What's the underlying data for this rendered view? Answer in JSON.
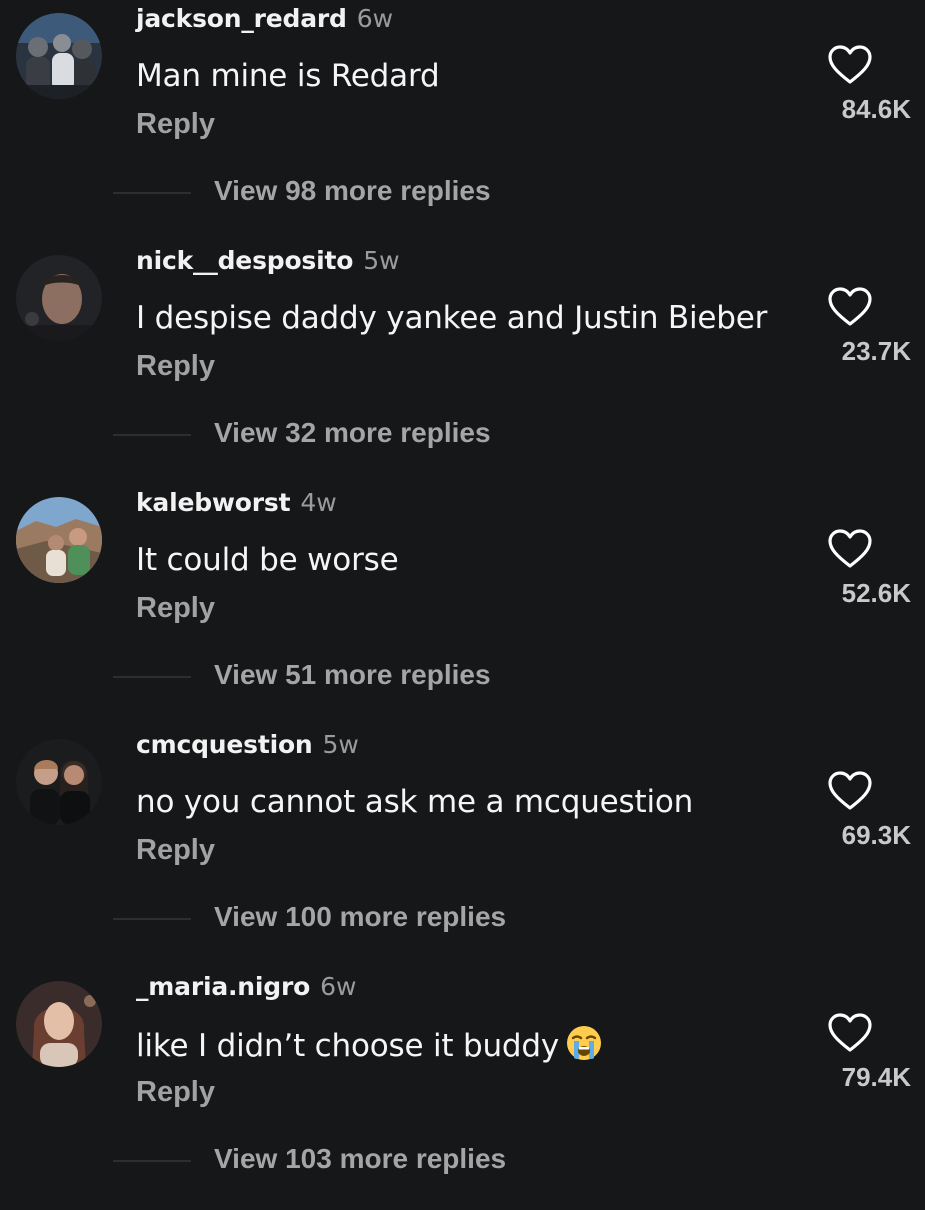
{
  "comments": [
    {
      "username": "jackson_redard",
      "age": "6w",
      "text": "Man mine is Redard",
      "reply_label": "Reply",
      "likes": "84.6K",
      "view_replies": "View 98 more replies",
      "avatar_icon": "avatar-group-photo"
    },
    {
      "username": "nick__desposito",
      "age": "5w",
      "text": "I despise daddy yankee and Justin Bieber",
      "reply_label": "Reply",
      "likes": "23.7K",
      "view_replies": "View 32 more replies",
      "avatar_icon": "avatar-selfie"
    },
    {
      "username": "kalebworst",
      "age": "4w",
      "text": "It could be worse",
      "reply_label": "Reply",
      "likes": "52.6K",
      "view_replies": "View 51 more replies",
      "avatar_icon": "avatar-outdoor-couple"
    },
    {
      "username": "cmcquestion",
      "age": "5w",
      "text": "no you cannot ask me a mcquestion",
      "reply_label": "Reply",
      "likes": "69.3K",
      "view_replies": "View 100 more replies",
      "avatar_icon": "avatar-couple-dark"
    },
    {
      "username": "_maria.nigro",
      "age": "6w",
      "text": "like I didn’t choose it buddy",
      "emoji": "loudly-crying-face-emoji",
      "reply_label": "Reply",
      "likes": "79.4K",
      "view_replies": "View 103 more replies",
      "avatar_icon": "avatar-portrait"
    }
  ],
  "colors": {
    "background": "#161719",
    "username": "#f2f2f2",
    "secondary_text": "#a1a2a4",
    "heart_outline": "#ffffff"
  }
}
